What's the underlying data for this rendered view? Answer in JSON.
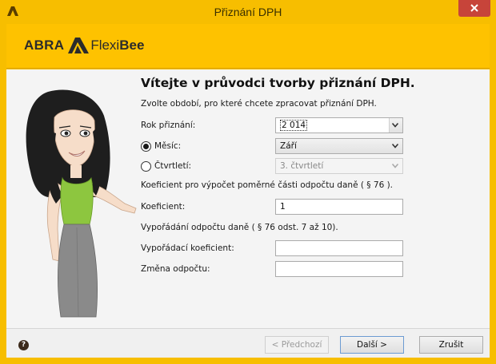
{
  "window": {
    "title": "Přiznání DPH"
  },
  "header": {
    "logo_abra": "ABRA",
    "logo_flexi": "Flexi",
    "logo_bee": "Bee"
  },
  "wizard": {
    "heading": "Vítejte v průvodci tvorby přiznání DPH.",
    "intro": "Zvolte období, pro které chcete zpracovat přiznání DPH.",
    "year_label": "Rok přiznání:",
    "year_value": "2 014",
    "month_label": "Měsíc:",
    "month_value": "Září",
    "month_selected": true,
    "quarter_label": "Čtvrtletí:",
    "quarter_value": "3. čtvrtletí",
    "coef_info": "Koeficient pro výpočet poměrné části odpočtu daně ( § 76 ).",
    "coef_label": "Koeficient:",
    "coef_value": "1",
    "settle_info": "Vypořádání odpočtu daně ( § 76 odst. 7 až 10).",
    "settle_coef_label": "Vypořádací koeficient:",
    "settle_coef_value": "",
    "change_label": "Změna odpočtu:",
    "change_value": ""
  },
  "footer": {
    "help_icon": "?",
    "prev_label": "< Předchozí",
    "next_label": "Další >",
    "cancel_label": "Zrušit"
  },
  "colors": {
    "accent": "#fec200",
    "close": "#c7443a",
    "dress": "#8dc63f"
  }
}
